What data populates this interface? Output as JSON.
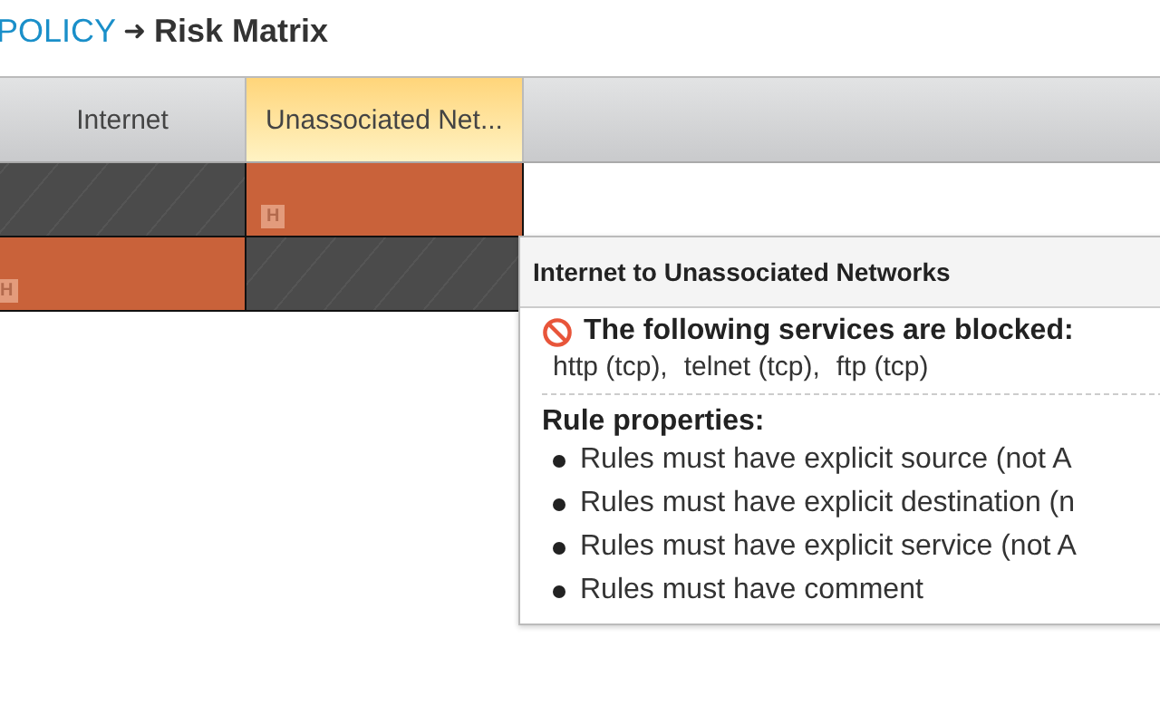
{
  "breadcrumb": {
    "parent": "POLICY",
    "separator": "➜",
    "current": "Risk Matrix"
  },
  "columns": [
    {
      "label": "Internet",
      "selected": false
    },
    {
      "label": "Unassociated Net...",
      "selected": true
    }
  ],
  "rows": [
    {
      "cells": [
        {
          "kind": "same"
        },
        {
          "kind": "risk",
          "badge": "H"
        }
      ]
    },
    {
      "cells": [
        {
          "kind": "risk",
          "badge": "H"
        },
        {
          "kind": "same"
        }
      ]
    }
  ],
  "tooltip": {
    "title": "Internet to Unassociated Networks",
    "blocked_heading": "The following services are blocked:",
    "services": [
      "http (tcp),",
      "telnet (tcp),",
      "ftp (tcp)"
    ],
    "rules_heading": "Rule properties:",
    "rules": [
      "Rules must have explicit source (not A",
      "Rules must have explicit destination (n",
      "Rules must have explicit service (not A",
      "Rules must have comment"
    ]
  }
}
